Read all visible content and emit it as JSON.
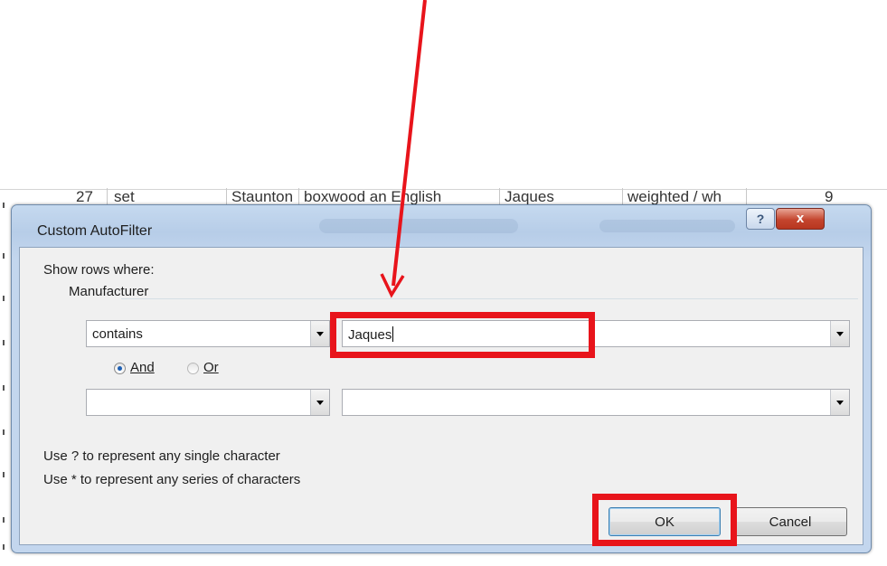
{
  "background_row": {
    "cells": [
      "27",
      "set",
      "Staunton",
      "boxwood an English",
      "Jaques",
      "weighted / wh",
      "9"
    ]
  },
  "dialog": {
    "title": "Custom AutoFilter",
    "help_label": "?",
    "close_label": "x",
    "show_rows_label": "Show rows where:",
    "field_name": "Manufacturer",
    "row1": {
      "operator": "contains",
      "value": "Jaques"
    },
    "and_label": "And",
    "or_label": "Or",
    "selected_logic": "And",
    "row2": {
      "operator": "",
      "value": ""
    },
    "hint1": "Use ? to represent any single character",
    "hint2": "Use * to represent any series of characters",
    "ok_label": "OK",
    "cancel_label": "Cancel"
  },
  "annotation": {
    "highlight_color": "#e8141b",
    "arrow_color": "#e8141b"
  }
}
